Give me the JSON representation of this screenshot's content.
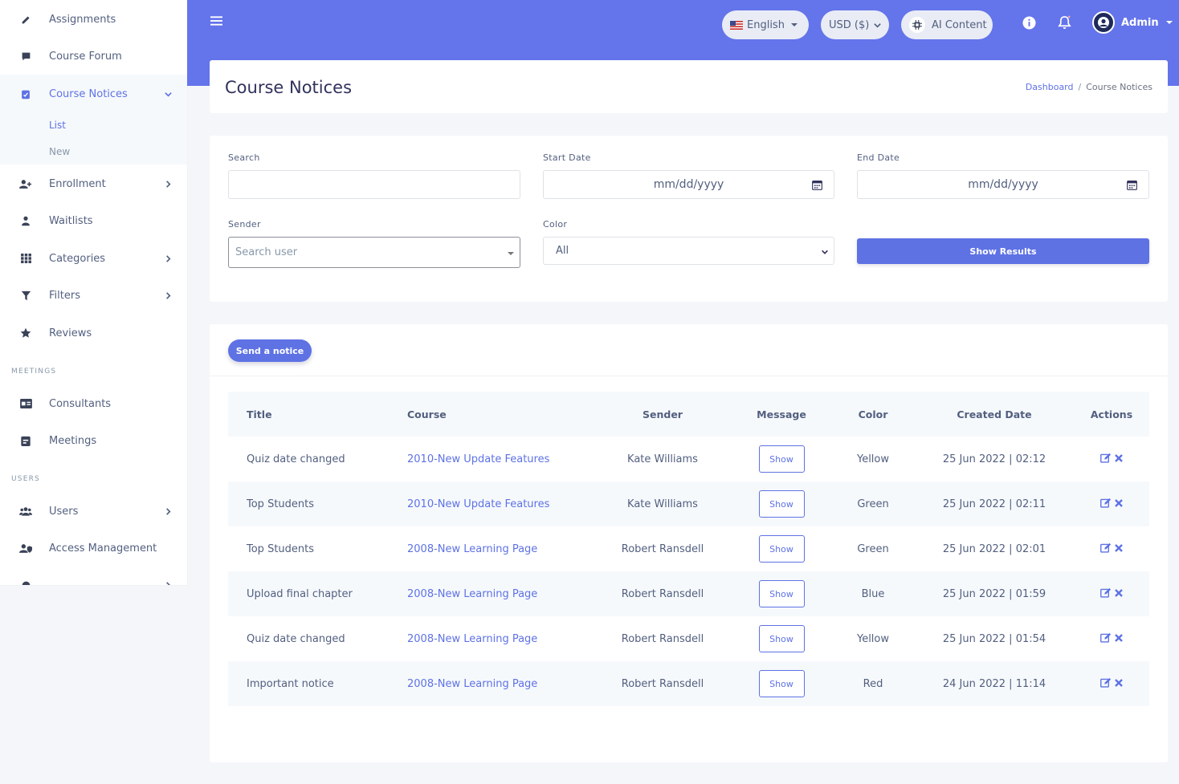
{
  "sidebar": {
    "items": [
      {
        "label": "Assignments",
        "icon": "pencil-icon"
      },
      {
        "label": "Course Forum",
        "icon": "comment-icon"
      },
      {
        "label": "Course Notices",
        "icon": "clipboard-check-icon"
      },
      {
        "label": "Enrollment",
        "icon": "user-plus-icon"
      },
      {
        "label": "Waitlists",
        "icon": "user-clock-icon"
      },
      {
        "label": "Categories",
        "icon": "grid-icon"
      },
      {
        "label": "Filters",
        "icon": "filter-icon"
      },
      {
        "label": "Reviews",
        "icon": "star-icon"
      },
      {
        "label": "Consultants",
        "icon": "id-card-icon"
      },
      {
        "label": "Meetings",
        "icon": "calendar-icon"
      },
      {
        "label": "Users",
        "icon": "users-icon"
      },
      {
        "label": "Access Management",
        "icon": "user-shield-icon"
      }
    ],
    "sub_items": [
      "List",
      "New"
    ],
    "sections": [
      "MEETINGS",
      "USERS"
    ]
  },
  "header": {
    "language": "English",
    "currency": "USD ($)",
    "ai": "AI Content",
    "user": "Admin"
  },
  "page": {
    "title": "Course Notices",
    "breadcrumb": [
      "Dashboard",
      "Course Notices"
    ]
  },
  "filters": {
    "search_label": "Search",
    "start_label": "Start Date",
    "end_label": "End Date",
    "date_placeholder": "mm/dd/yyyy",
    "sender_label": "Sender",
    "sender_placeholder": "Search user",
    "color_label": "Color",
    "color_value": "All",
    "submit": "Show Results"
  },
  "table": {
    "send_button": "Send a notice",
    "show_label": "Show",
    "headers": [
      "Title",
      "Course",
      "Sender",
      "Message",
      "Color",
      "Created Date",
      "Actions"
    ],
    "rows": [
      {
        "title": "Quiz date changed",
        "course": "2010-New Update Features",
        "sender": "Kate Williams",
        "color": "Yellow",
        "created": "25 Jun 2022 | 02:12"
      },
      {
        "title": "Top Students",
        "course": "2010-New Update Features",
        "sender": "Kate Williams",
        "color": "Green",
        "created": "25 Jun 2022 | 02:11"
      },
      {
        "title": "Top Students",
        "course": "2008-New Learning Page",
        "sender": "Robert Ransdell",
        "color": "Green",
        "created": "25 Jun 2022 | 02:01"
      },
      {
        "title": "Upload final chapter",
        "course": "2008-New Learning Page",
        "sender": "Robert Ransdell",
        "color": "Blue",
        "created": "25 Jun 2022 | 01:59"
      },
      {
        "title": "Quiz date changed",
        "course": "2008-New Learning Page",
        "sender": "Robert Ransdell",
        "color": "Yellow",
        "created": "25 Jun 2022 | 01:54"
      },
      {
        "title": "Important notice",
        "course": "2008-New Learning Page",
        "sender": "Robert Ransdell",
        "color": "Red",
        "created": "24 Jun 2022 | 11:14"
      }
    ]
  },
  "colors": {
    "accent": "#5e72e4",
    "topbar": "#6474ea"
  }
}
